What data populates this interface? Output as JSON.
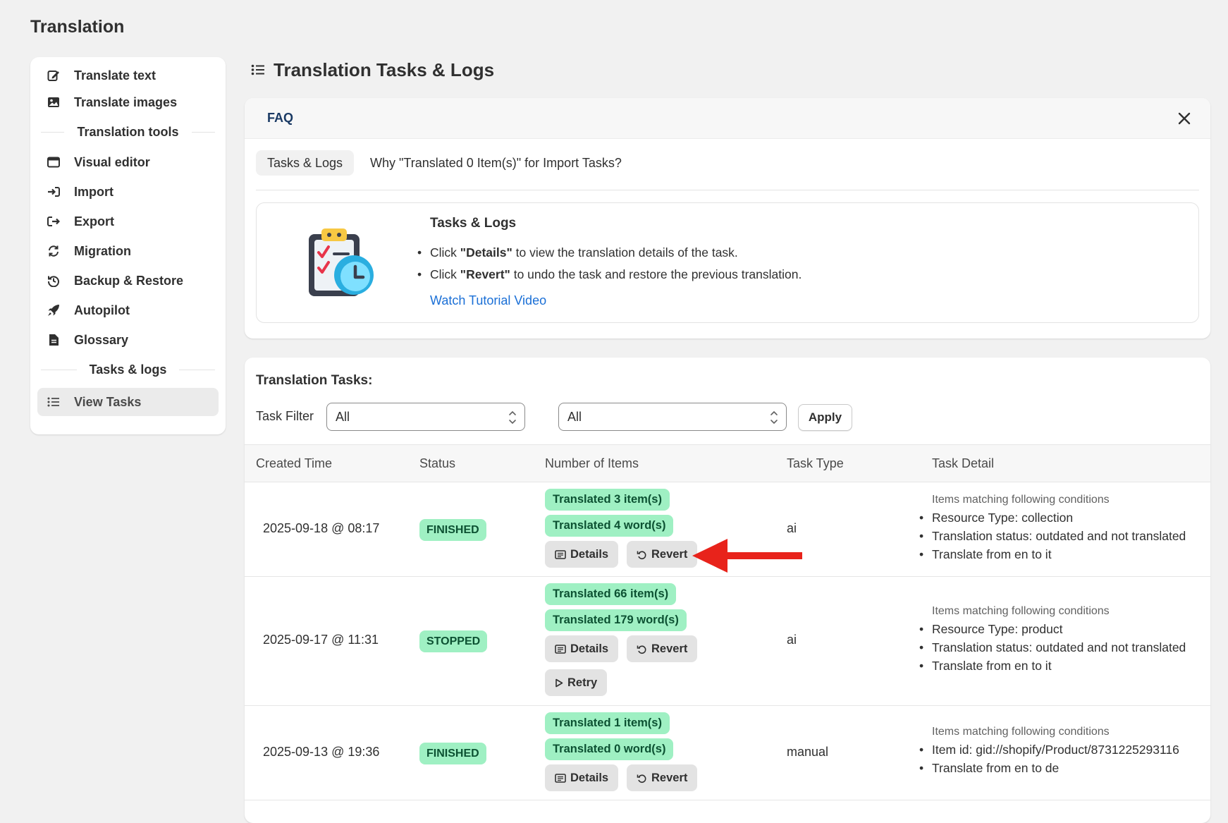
{
  "app_title": "Translation",
  "sidebar": {
    "items": [
      {
        "label": "Translate text",
        "icon": "edit-icon"
      },
      {
        "label": "Translate images",
        "icon": "image-icon"
      }
    ],
    "section1": "Translation tools",
    "tools": [
      {
        "label": "Visual editor",
        "icon": "window-icon"
      },
      {
        "label": "Import",
        "icon": "import-icon"
      },
      {
        "label": "Export",
        "icon": "export-icon"
      },
      {
        "label": "Migration",
        "icon": "refresh-icon"
      },
      {
        "label": "Backup & Restore",
        "icon": "history-icon"
      },
      {
        "label": "Autopilot",
        "icon": "rocket-icon"
      },
      {
        "label": "Glossary",
        "icon": "document-icon"
      }
    ],
    "section2": "Tasks & logs",
    "logs": [
      {
        "label": "View Tasks",
        "icon": "list-icon",
        "active": true
      }
    ]
  },
  "main": {
    "heading": "Translation Tasks & Logs"
  },
  "faq": {
    "title": "FAQ",
    "tabs": [
      "Tasks & Logs",
      "Why \"Translated 0 Item(s)\" for Import Tasks?"
    ],
    "body_title": "Tasks & Logs",
    "bullets": [
      {
        "pre": "Click ",
        "bold": "\"Details\"",
        "post": " to view the translation details of the task."
      },
      {
        "pre": "Click ",
        "bold": "\"Revert\"",
        "post": " to undo the task and restore the previous translation."
      }
    ],
    "link": "Watch Tutorial Video"
  },
  "tasks": {
    "title": "Translation Tasks:",
    "filter_label": "Task Filter",
    "filter1": "All",
    "filter2": "All",
    "apply": "Apply",
    "columns": [
      "Created Time",
      "Status",
      "Number of Items",
      "Task Type",
      "Task Detail"
    ],
    "buttons": {
      "details": "Details",
      "revert": "Revert",
      "retry": "Retry"
    },
    "detail_caption": "Items matching following conditions",
    "rows": [
      {
        "time": "2025-09-18 @ 08:17",
        "status": "FINISHED",
        "items": "Translated 3 item(s)",
        "words": "Translated 4 word(s)",
        "type": "ai",
        "details": [
          "Resource Type: collection",
          "Translation status: outdated and not translated",
          "Translate from en to it"
        ]
      },
      {
        "time": "2025-09-17 @ 11:31",
        "status": "STOPPED",
        "items": "Translated 66 item(s)",
        "words": "Translated 179 word(s)",
        "type": "ai",
        "details": [
          "Resource Type: product",
          "Translation status: outdated and not translated",
          "Translate from en to it"
        ]
      },
      {
        "time": "2025-09-13 @ 19:36",
        "status": "FINISHED",
        "items": "Translated 1 item(s)",
        "words": "Translated 0 word(s)",
        "type": "manual",
        "details": [
          "Item id: gid://shopify/Product/8731225293116",
          "Translate from en to de"
        ]
      }
    ]
  },
  "colors": {
    "status_bg": "#9ff0c3",
    "status_text": "#0c5132",
    "link": "#1a6fd6",
    "arrow": "#e8231b"
  }
}
